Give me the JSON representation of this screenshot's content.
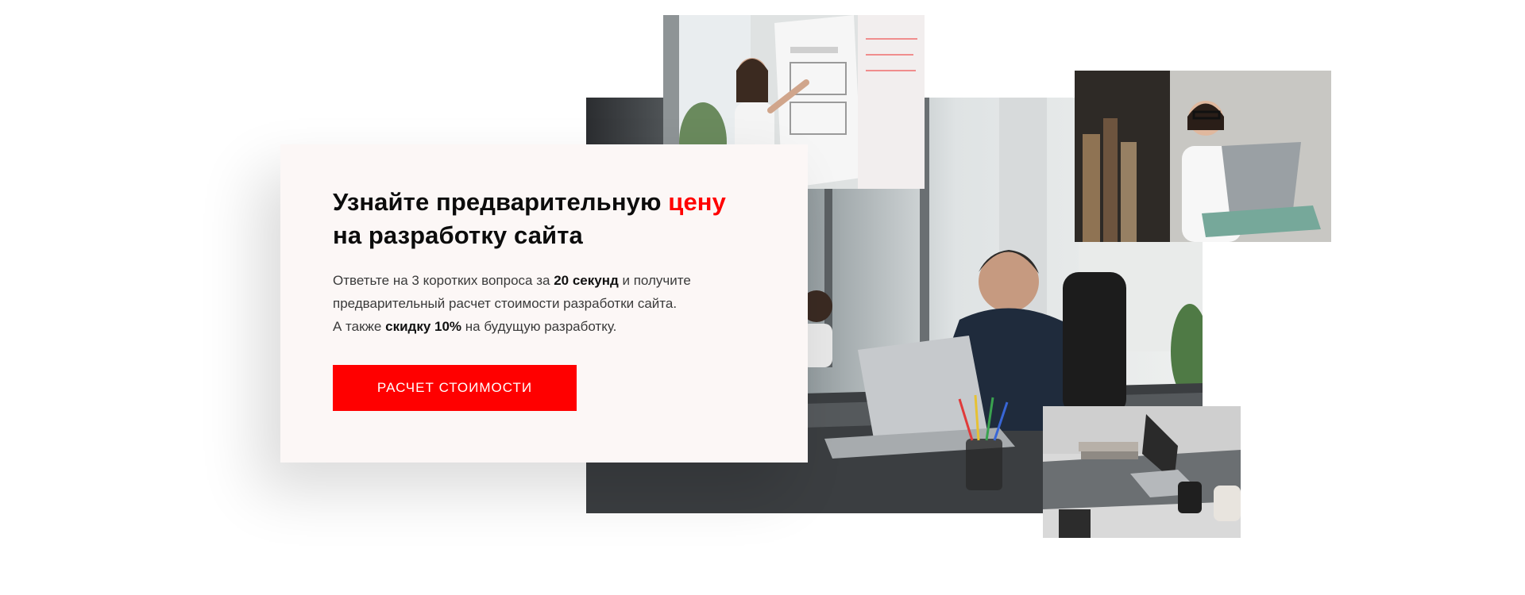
{
  "promo": {
    "title_part1": "Узнайте предварительную ",
    "title_accent": "цену",
    "title_part2": "на разработку сайта",
    "text_line1_a": "Ответьте на 3 коротких вопроса за ",
    "text_line1_b": "20 секунд",
    "text_line1_c": " и получите",
    "text_line2": "предварительный расчет стоимости разработки сайта.",
    "text_line3_a": "А также ",
    "text_line3_b": "скидку 10%",
    "text_line3_c": " на будущую разработку.",
    "button_label": "РАСЧЕТ СТОИМОСТИ"
  },
  "colors": {
    "accent": "#ff0000",
    "card_background": "#fcf7f6",
    "button_text": "#ffffff"
  },
  "images": [
    "office-man-laptop-photo",
    "presenter-whiteboard-photo",
    "designer-laptop-photo",
    "desk-laptop-photo"
  ]
}
